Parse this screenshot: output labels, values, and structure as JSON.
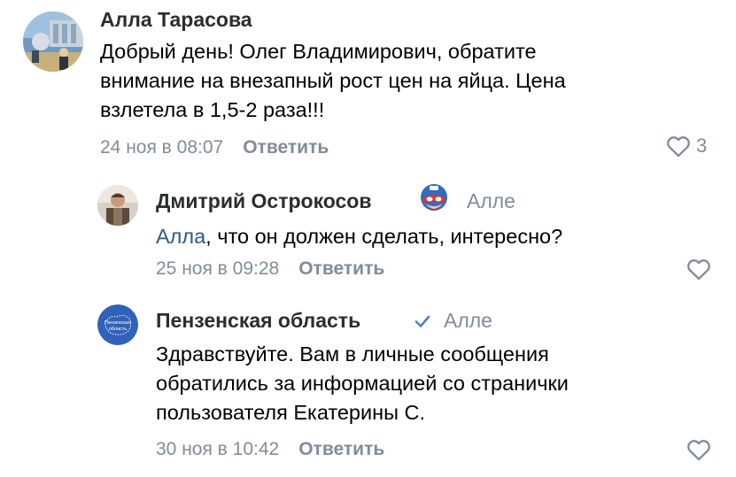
{
  "colors": {
    "author": "#2c2d2e",
    "secondary": "#818c99",
    "mention": "#2a5885",
    "verified": "#5181b8"
  },
  "comments": [
    {
      "author": "Алла Тарасова",
      "text_lines": [
        "Добрый день! Олег Владимирович, обратите",
        "внимание на внезапный рост цен на яйца. Цена",
        "взлетела в 1,5-2 раза!!!"
      ],
      "date": "24 ноя в 08:07",
      "reply_label": "Ответить",
      "likes": "3",
      "avatar_icon": "user-photo-avatar",
      "like_icon": "heart-outline-icon"
    },
    {
      "author": "Дмитрий Острокосов",
      "badge_icon": "superhero-mask-icon",
      "reply_to": "Алле",
      "mention": "Алла",
      "text_rest": ", что он должен сделать, интересно?",
      "date": "25 ноя в 09:28",
      "reply_label": "Ответить",
      "avatar_icon": "user-photo-avatar",
      "like_icon": "heart-outline-icon"
    },
    {
      "author": "Пензенская область",
      "badge_icon": "verified-check-icon",
      "reply_to": "Алле",
      "avatar_text": "Пензенская область",
      "text_lines": [
        "Здравствуйте. Вам в личные сообщения",
        "обратились за информацией со странички",
        "пользователя Екатерины С."
      ],
      "date": "30 ноя в 10:42",
      "reply_label": "Ответить",
      "like_icon": "heart-outline-icon"
    }
  ]
}
